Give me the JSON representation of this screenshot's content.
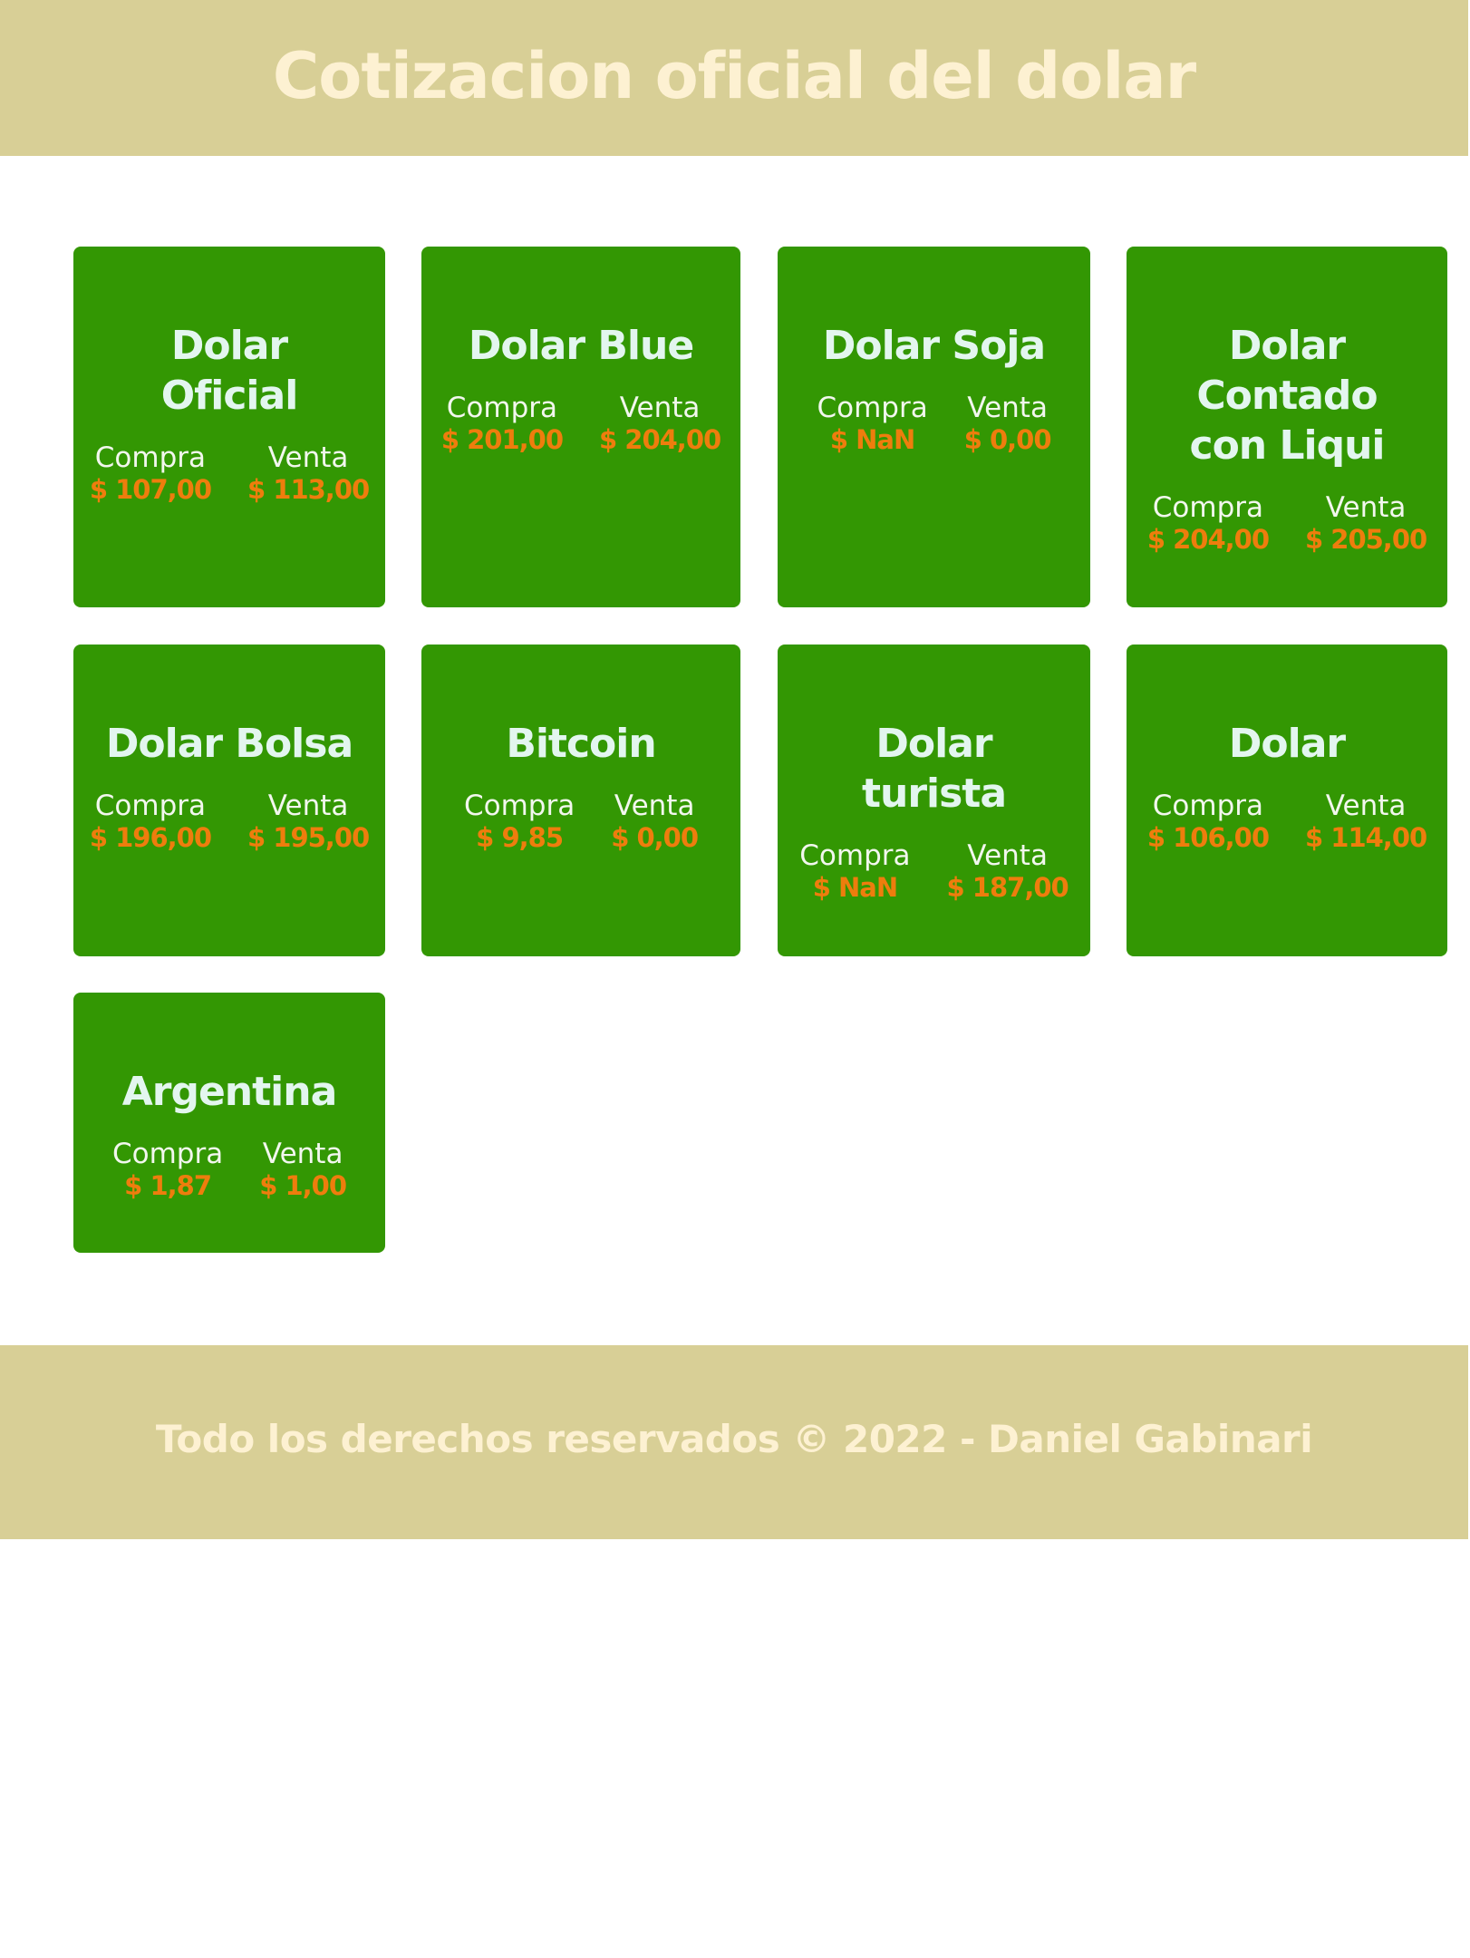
{
  "header": {
    "title": "Cotizacion oficial del dolar"
  },
  "cards": [
    {
      "name": "Dolar Oficial",
      "compra_label": "Compra",
      "venta_label": "Venta",
      "compra": "$ 107,00",
      "venta": "$ 113,00"
    },
    {
      "name": "Dolar Blue",
      "compra_label": "Compra",
      "venta_label": "Venta",
      "compra": "$ 201,00",
      "venta": "$ 204,00"
    },
    {
      "name": "Dolar Soja",
      "compra_label": "Compra",
      "venta_label": "Venta",
      "compra": "$ NaN",
      "venta": "$ 0,00"
    },
    {
      "name": "Dolar Contado con Liqui",
      "compra_label": "Compra",
      "venta_label": "Venta",
      "compra": "$ 204,00",
      "venta": "$ 205,00"
    },
    {
      "name": "Dolar Bolsa",
      "compra_label": "Compra",
      "venta_label": "Venta",
      "compra": "$ 196,00",
      "venta": "$ 195,00"
    },
    {
      "name": "Bitcoin",
      "compra_label": "Compra",
      "venta_label": "Venta",
      "compra": "$ 9,85",
      "venta": "$ 0,00"
    },
    {
      "name": "Dolar turista",
      "compra_label": "Compra",
      "venta_label": "Venta",
      "compra": "$ NaN",
      "venta": "$ 187,00"
    },
    {
      "name": "Dolar",
      "compra_label": "Compra",
      "venta_label": "Venta",
      "compra": "$ 106,00",
      "venta": "$ 114,00"
    },
    {
      "name": "Argentina",
      "compra_label": "Compra",
      "venta_label": "Venta",
      "compra": "$ 1,87",
      "venta": "$ 1,00"
    }
  ],
  "footer": {
    "text": "Todo los derechos reservados © 2022 - Daniel Gabinari"
  },
  "colors": {
    "banner": "#d8cf96",
    "banner_text": "#fdf1d2",
    "card_bg": "#339703",
    "card_title": "#e3f6ef",
    "price_value": "#ee7d0d"
  }
}
